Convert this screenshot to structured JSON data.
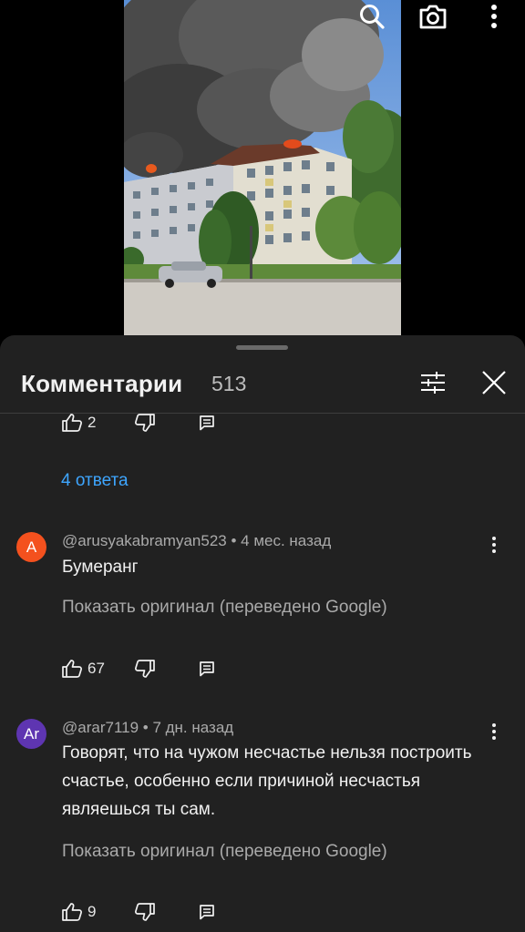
{
  "video": {
    "icons": {
      "search": "search-icon",
      "camera": "camera-icon",
      "menu": "more-vert-icon"
    }
  },
  "comments_panel": {
    "title": "Комментарии",
    "count": "513",
    "icons": {
      "filter": "filter-sliders-icon",
      "close": "close-icon"
    }
  },
  "previous_comment": {
    "likes": "2",
    "replies_link": "4 ответа"
  },
  "comments": [
    {
      "avatar_letter": "A",
      "avatar_color": "#f4511e",
      "handle": "@arusyakabramyan523",
      "time": " • 4 мес. назад",
      "text": "Бумеранг",
      "translate_label": "Показать оригинал (переведено Google)",
      "likes": "67"
    },
    {
      "avatar_letter": "Ar",
      "avatar_color": "#5e35b1",
      "handle": "@arar7119",
      "time": " • 7 дн. назад",
      "text": "Говорят, что на чужом несчастье нельзя построить счастье, особенно если причиной несчастья являешься ты сам.",
      "translate_label": "Показать оригинал (переведено Google)",
      "likes": "9"
    }
  ],
  "colors": {
    "sheet_bg": "#212121",
    "link": "#3ea6ff",
    "secondary_text": "#aaaaaa"
  }
}
